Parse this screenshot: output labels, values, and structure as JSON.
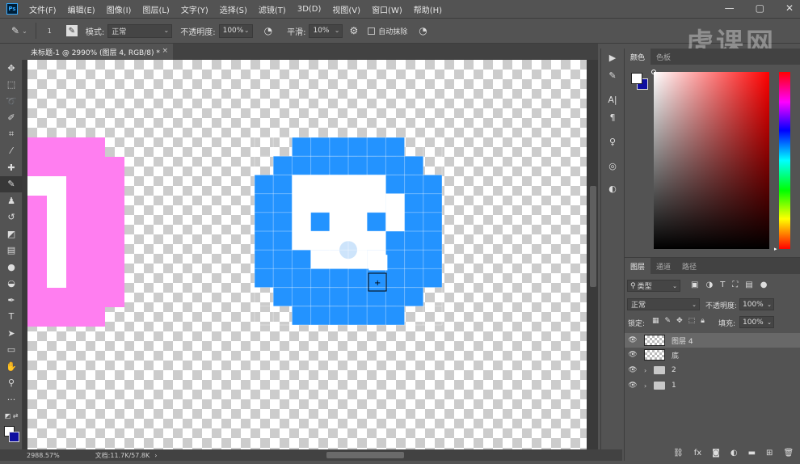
{
  "menubar": {
    "logo": "Ps",
    "items": [
      "文件(F)",
      "编辑(E)",
      "图像(I)",
      "图层(L)",
      "文字(Y)",
      "选择(S)",
      "滤镜(T)",
      "3D(D)",
      "视图(V)",
      "窗口(W)",
      "帮助(H)"
    ],
    "window_controls": [
      "—",
      "▢",
      "✕"
    ]
  },
  "options": {
    "brush_size": "1",
    "mode_label": "模式:",
    "mode_value": "正常",
    "opacity_label": "不透明度:",
    "opacity_value": "100%",
    "smooth_label": "平滑:",
    "smooth_value": "10%",
    "auto_erase_label": "自动抹除"
  },
  "watermark": "虎课网",
  "document": {
    "tab_title": "未标题-1 @ 2990% (图层 4, RGB/8) *",
    "tab_close": "×"
  },
  "status": {
    "zoom": "2988.57%",
    "doc_info": "文档:11.7K/57.8K"
  },
  "color_panel": {
    "tabs": [
      "颜色",
      "色板"
    ],
    "fg_color": "#ffffff",
    "bg_color": "#1010a0"
  },
  "layers_panel": {
    "tabs": [
      "图层",
      "通道",
      "路径"
    ],
    "filter_label": "类型",
    "blend_mode": "正常",
    "opacity_label": "不透明度:",
    "opacity_value": "100%",
    "lock_label": "锁定:",
    "fill_label": "填充:",
    "fill_value": "100%",
    "layers": [
      {
        "name": "图层 4",
        "kind": "pixel",
        "selected": true
      },
      {
        "name": "底",
        "kind": "pixel",
        "selected": false
      },
      {
        "name": "2",
        "kind": "group",
        "selected": false
      },
      {
        "name": "1",
        "kind": "group",
        "selected": false
      }
    ]
  },
  "art": {
    "pink": "#ff7ef0",
    "blue": "#2393ff",
    "white": "#ffffff",
    "light_blue": "#cde4fb"
  }
}
